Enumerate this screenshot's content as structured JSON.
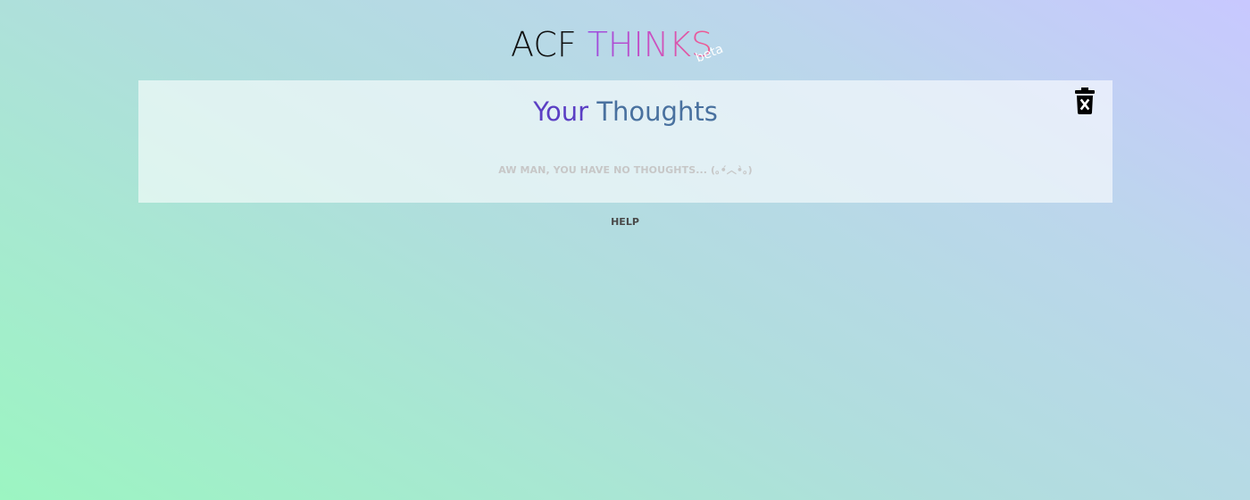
{
  "logo": {
    "part1": "ACF",
    "part2": "THINKS",
    "badge": "beta"
  },
  "panel": {
    "title_word1": "Your",
    "title_word2": "Thoughts",
    "empty_message": "AW MAN, YOU HAVE NO THOUGHTS... (｡•́︿•̀｡)",
    "clear_icon": "trash-x-icon"
  },
  "footer": {
    "help_label": "HELP"
  },
  "colors": {
    "title_accent": "#5b3fc4",
    "title_secondary": "#49719f",
    "logo_gradient_start": "#9b4ce0",
    "logo_gradient_end": "#f25c8f"
  }
}
